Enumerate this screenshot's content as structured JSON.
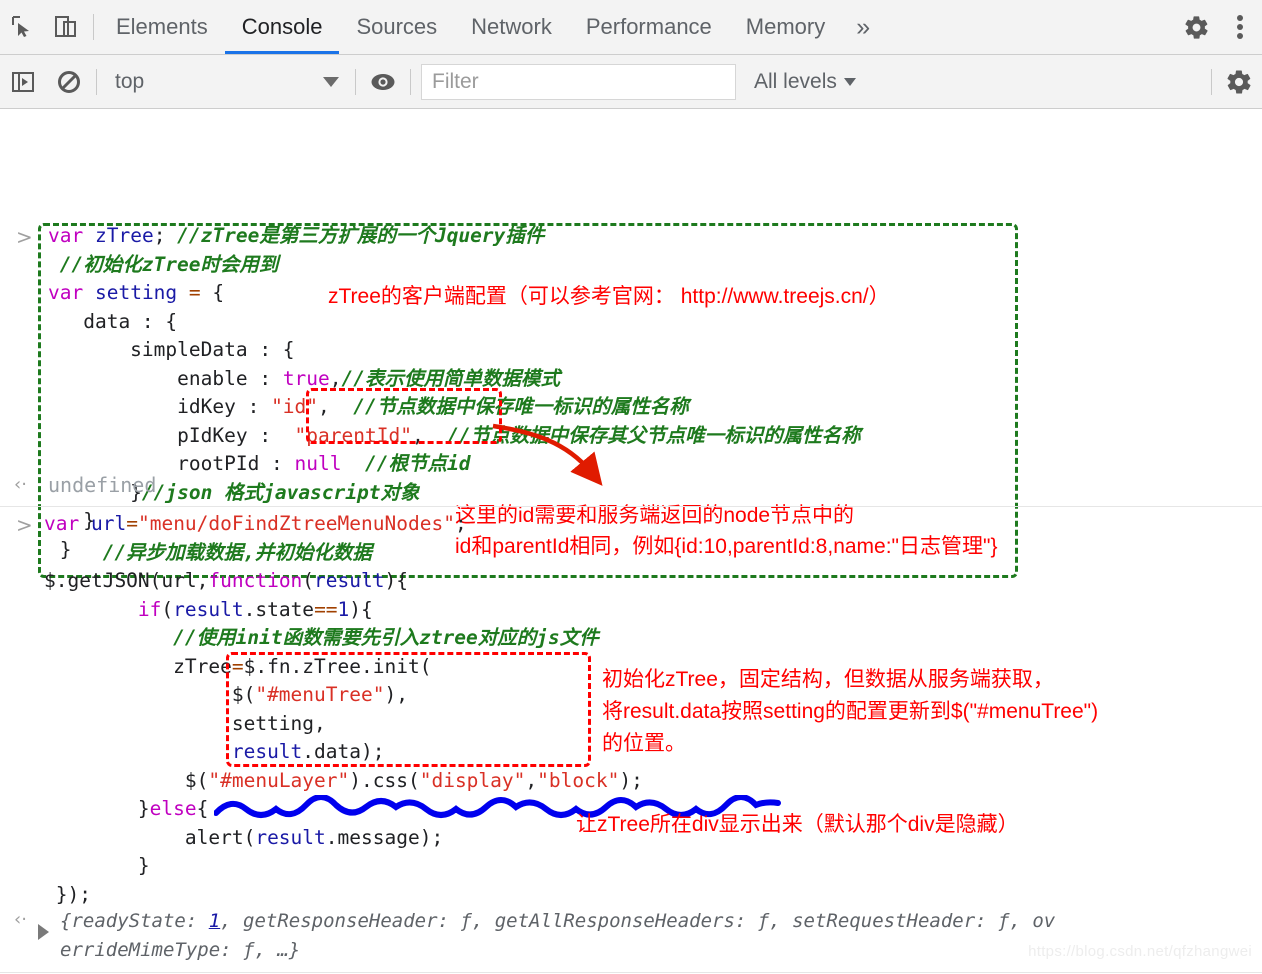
{
  "devtools": {
    "tabs": [
      {
        "label": "Elements",
        "active": false
      },
      {
        "label": "Console",
        "active": true
      },
      {
        "label": "Sources",
        "active": false
      },
      {
        "label": "Network",
        "active": false
      },
      {
        "label": "Performance",
        "active": false
      },
      {
        "label": "Memory",
        "active": false
      }
    ],
    "more_label": "»",
    "inspect_icon": "inspect-element-icon",
    "device_icon": "device-toolbar-icon",
    "settings_icon": "gear-icon",
    "menu_icon": "kebab-menu-icon"
  },
  "console_toolbar": {
    "sidebar_icon": "show-console-sidebar-icon",
    "clear_icon": "clear-console-icon",
    "context": "top",
    "eye_icon": "live-expression-icon",
    "filter_placeholder": "Filter",
    "filter_value": "",
    "levels_label": "All levels",
    "settings_icon": "gear-icon"
  },
  "console": {
    "entry1": {
      "prompt": ">",
      "code_lines": [
        "var zTree; //zTree是第三方扩展的一个Jquery插件",
        " //初始化zTree时会用到",
        "var setting = {",
        "   data : {",
        "       simpleData : {",
        "           enable : true,//表示使用简单数据模式",
        "           idKey : \"id\",  //节点数据中保存唯一标识的属性名称",
        "           pIdKey :  \"parentId\",  //节点数据中保存其父节点唯一标识的属性名称",
        "           rootPId : null  //根节点id",
        "       }//json 格式javascript对象",
        "   }",
        " }"
      ],
      "annotations": {
        "config_note": "zTree的客户端配置（可以参考官网： http://www.treejs.cn/）",
        "id_note_line1": "这里的id需要和服务端返回的node节点中的",
        "id_note_line2": "id和parentId相同，例如{id:10,parentId:8,name:\"日志管理\"}"
      },
      "result_prompt": "‹·",
      "result": "undefined"
    },
    "entry2": {
      "prompt": ">",
      "code_lines": [
        "var url=\"menu/doFindZtreeMenuNodes\";",
        "     //异步加载数据,并初始化数据",
        "$.getJSON(url,function(result){",
        "        if(result.state==1){",
        "           //使用init函数需要先引入ztree对应的js文件",
        "           zTree=$.fn.zTree.init(",
        "                $(\"#menuTree\"),",
        "                setting,",
        "                result.data);",
        "            $(\"#menuLayer\").css(\"display\",\"block\");",
        "        }else{",
        "            alert(result.message);",
        "        }",
        " });"
      ],
      "annotations": {
        "init_note_line1": "初始化zTree，固定结构，但数据从服务端获取，",
        "init_note_line2": "将result.data按照setting的配置更新到$(\"#menuTree\")",
        "init_note_line3": "的位置。",
        "display_note": "让zTree所在div显示出来（默认那个div是隐藏）"
      },
      "result_prompt": "‹·",
      "result_line1_a": "{readyState: ",
      "result_line1_n": "1",
      "result_line1_b": ", getResponseHeader: ƒ, getAllResponseHeaders: ƒ, setRequestHeader: ƒ, ov",
      "result_line2": "errideMimeType: ƒ, …}"
    }
  },
  "watermark": "https://blog.csdn.net/qfzhangwei",
  "colors": {
    "accent": "#1a73e8",
    "keyword": "#c000c0",
    "string": "#d93025",
    "comment": "#1e7a1e",
    "annotation": "#ff0000",
    "green_box": "#1e7a1e",
    "red_box": "#ff0000",
    "blue_squiggle": "#0000ee"
  }
}
